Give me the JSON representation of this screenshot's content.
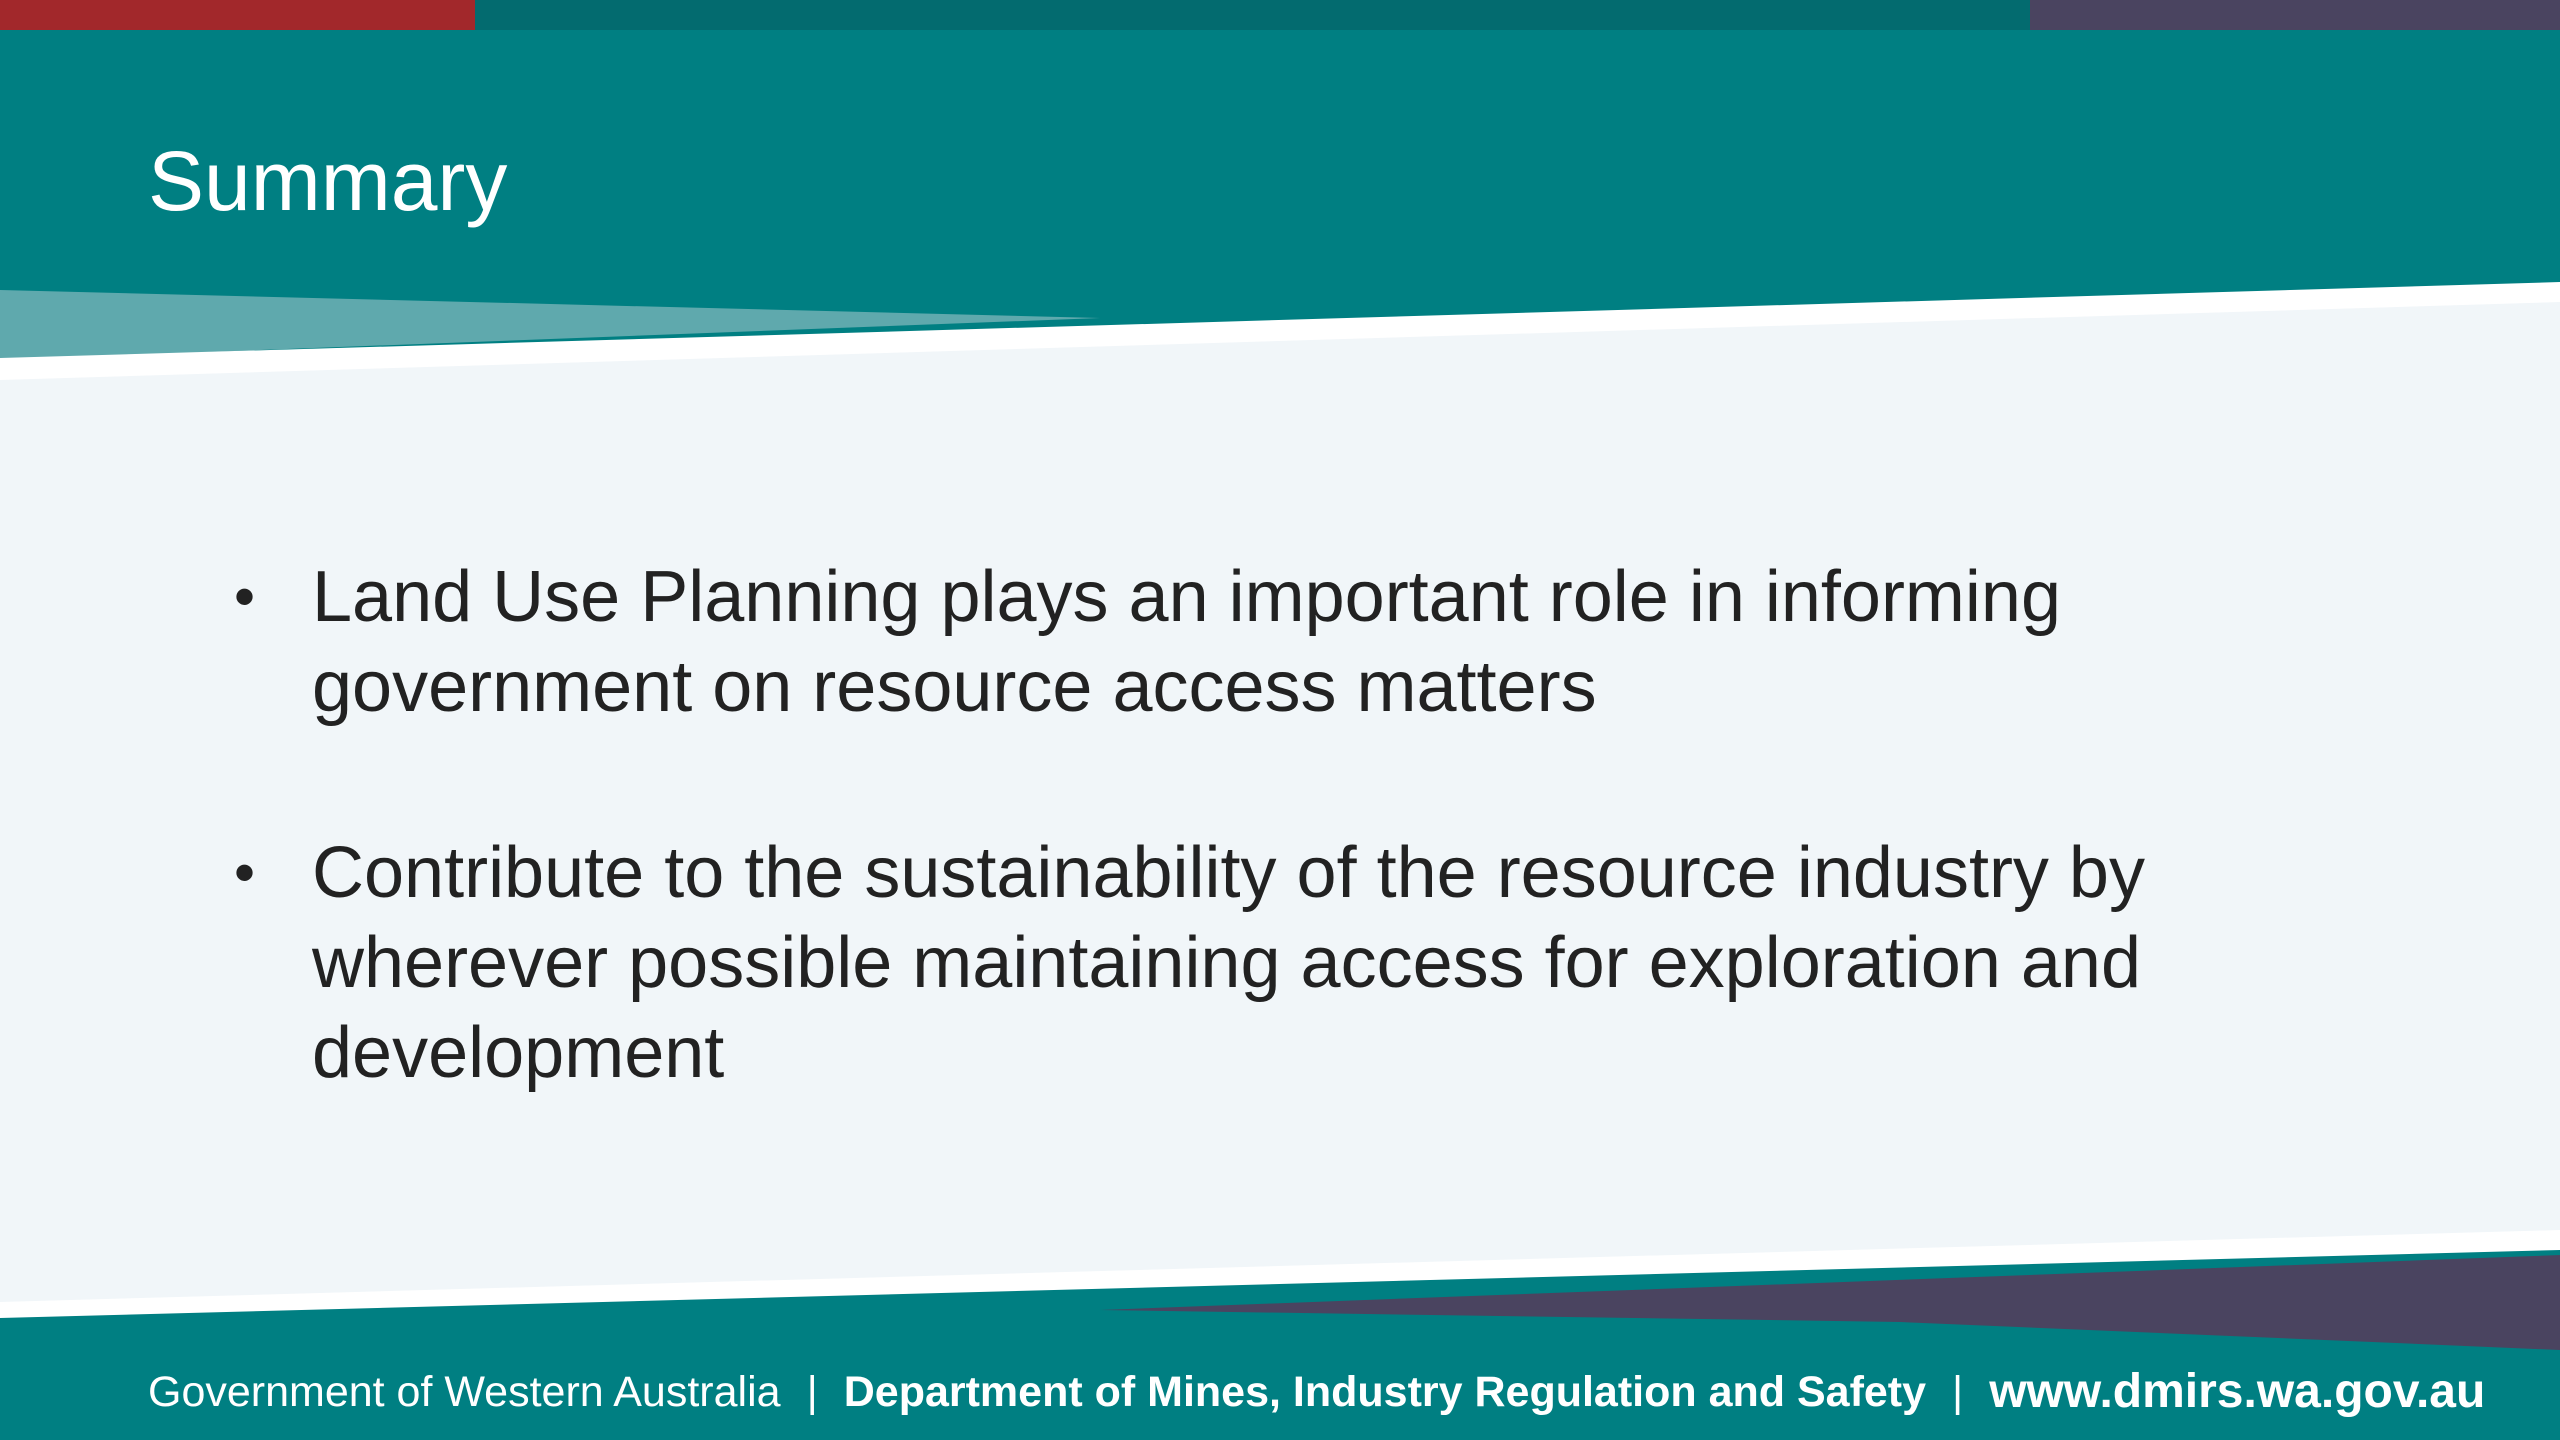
{
  "slide": {
    "title": "Summary",
    "bullets": [
      {
        "marker": "•",
        "lines": [
          "Land Use Planning plays an important role in informing",
          "government on resource access matters"
        ]
      },
      {
        "marker": "•",
        "lines": [
          "Contribute to the sustainability of the resource industry by",
          "wherever possible maintaining access for exploration and",
          "development"
        ]
      }
    ]
  },
  "footer": {
    "government": "Government of Western Australia",
    "separator": "|",
    "department": "Department of Mines, Industry Regulation and Safety",
    "url": "www.dmirs.wa.gov.au"
  },
  "colors": {
    "teal": "#007f82",
    "light_teal": "#5fa9ad",
    "red": "#a2282b",
    "purple": "#4a4460",
    "dark_teal": "#036b6f",
    "content_bg": "#f1f6f9"
  }
}
